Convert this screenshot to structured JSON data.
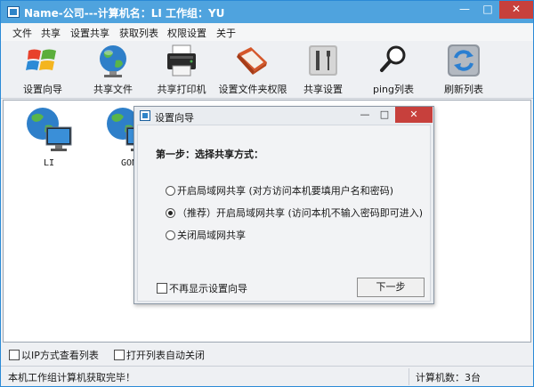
{
  "window": {
    "title": "Name-公司---计算机名：LI  工作组：YU",
    "min": "—",
    "max": "□",
    "close": "✕"
  },
  "menu": [
    "文件",
    "共享",
    "设置共享",
    "获取列表",
    "权限设置",
    "关于"
  ],
  "toolbar": [
    {
      "label": "设置向导",
      "icon": "windows-logo-icon"
    },
    {
      "label": "共享文件",
      "icon": "globe-icon"
    },
    {
      "label": "共享打印机",
      "icon": "printer-icon"
    },
    {
      "label": "设置文件夹权限",
      "icon": "folder-permission-icon"
    },
    {
      "label": "共享设置",
      "icon": "tools-icon"
    },
    {
      "label": "ping列表",
      "icon": "magnifier-icon"
    },
    {
      "label": "刷新列表",
      "icon": "refresh-icon"
    }
  ],
  "computers": [
    {
      "name": "LI"
    },
    {
      "name": "GON"
    }
  ],
  "options": {
    "ip_view": "以IP方式查看列表",
    "auto_close": "打开列表自动关闭"
  },
  "status": {
    "message": "本机工作组计算机获取完毕！",
    "count": "计算机数：3台"
  },
  "dialog": {
    "title": "设置向导",
    "step": "第一步：选择共享方式：",
    "options": [
      "开启局域网共享 (对方访问本机要填用户名和密码)",
      "（推荐）开启局域网共享 (访问本机不输入密码即可进入)",
      "关闭局域网共享"
    ],
    "selected_index": 1,
    "no_show": "不再显示设置向导",
    "next": "下一步"
  }
}
